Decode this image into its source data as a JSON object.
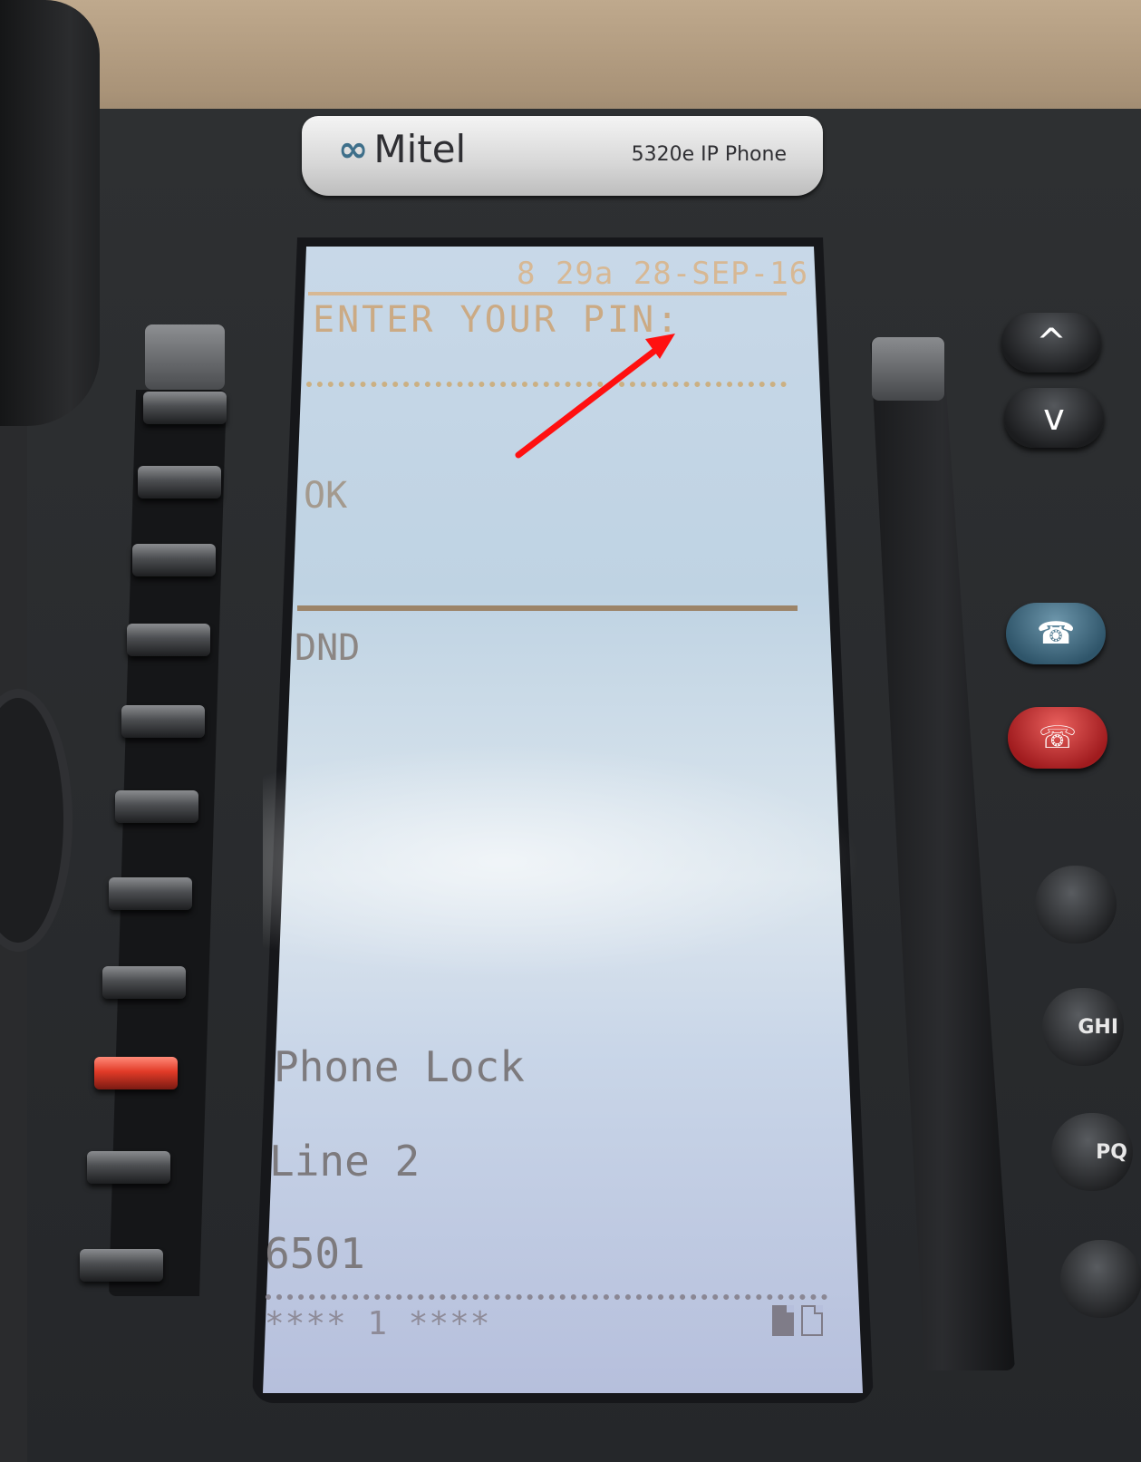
{
  "brand": {
    "logo_text": "Mitel",
    "model": "5320e IP Phone"
  },
  "screen": {
    "clock": "8 29a 28-SEP-16",
    "prompt": "ENTER YOUR PIN:",
    "softkey_ok": "OK",
    "softkey_dnd": "DND",
    "lines": [
      {
        "label": "Phone Lock"
      },
      {
        "label": "Line 2"
      },
      {
        "label": "6501"
      }
    ],
    "status": "**** 1 ****",
    "status_icons": [
      "document-filled-icon",
      "document-outline-icon"
    ]
  },
  "nav": {
    "up": "^",
    "down": "v"
  },
  "dialpad": {
    "visible_partial_labels": [
      "GHI",
      "PQ"
    ]
  },
  "colors": {
    "lcd_accent": "#cbaa84",
    "annotation_arrow": "#ff1010",
    "hold_key": "#3f6d85",
    "release_key": "#c7282a",
    "lit_line_key": "#e23b28"
  }
}
